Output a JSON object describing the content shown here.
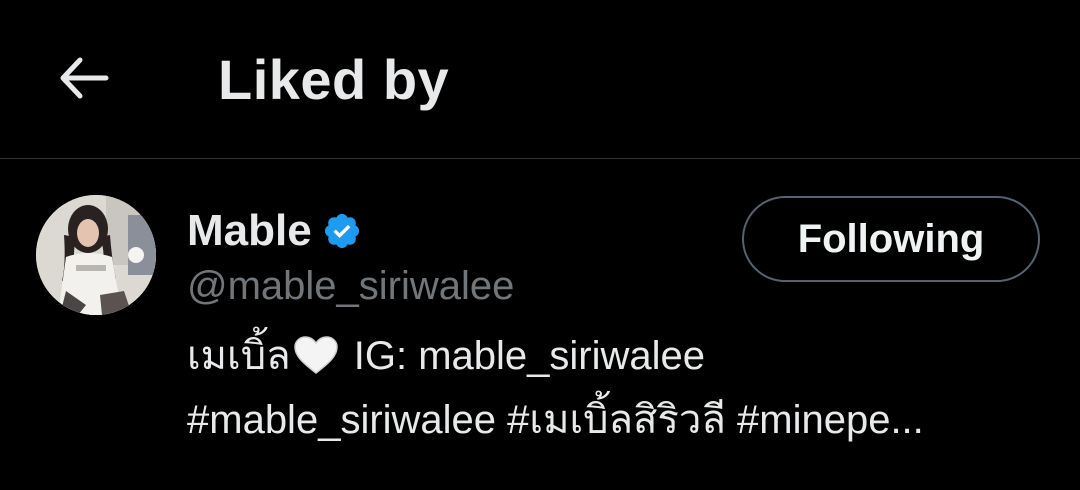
{
  "header": {
    "title": "Liked by",
    "back_icon": "arrow-left-icon"
  },
  "user": {
    "display_name": "Mable",
    "verified": true,
    "verified_color": "#1d9bf0",
    "handle": "@mable_siriwalee",
    "follow_label": "Following",
    "bio": {
      "line1_prefix": "เมเบิ้ล",
      "line1_emoji": "white-heart-icon",
      "line1_suffix": " IG: mable_siriwalee",
      "line2": "#mable_siriwalee #เมเบิ้ลสิริวลี #minepe..."
    }
  },
  "colors": {
    "background": "#000000",
    "text_primary": "#e7e9ea",
    "text_secondary": "#71767b",
    "divider": "#2f3336",
    "button_border": "#536471"
  }
}
